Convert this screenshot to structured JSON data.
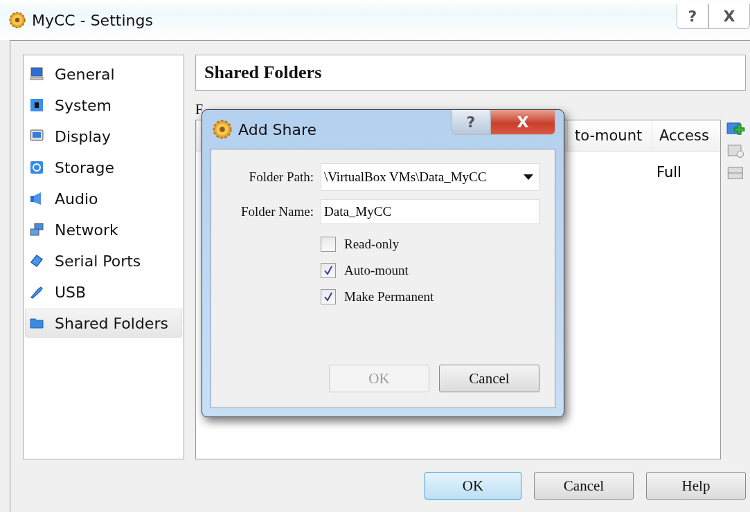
{
  "window": {
    "title": "MyCC - Settings",
    "buttons": [
      "?",
      "X"
    ]
  },
  "sidebar": {
    "items": [
      {
        "label": "General",
        "selected": false
      },
      {
        "label": "System",
        "selected": false
      },
      {
        "label": "Display",
        "selected": false
      },
      {
        "label": "Storage",
        "selected": false
      },
      {
        "label": "Audio",
        "selected": false
      },
      {
        "label": "Network",
        "selected": false
      },
      {
        "label": "Serial Ports",
        "selected": false
      },
      {
        "label": "USB",
        "selected": false
      },
      {
        "label": "Shared Folders",
        "selected": true
      }
    ]
  },
  "page": {
    "title": "Shared Folders",
    "folder_list_label": "F",
    "table": {
      "columns": [
        "to-mount",
        "Access"
      ],
      "rows": [
        [
          "",
          "Full"
        ]
      ]
    },
    "toolbar": [
      {
        "kind": "add",
        "disabled": false
      },
      {
        "kind": "edit",
        "disabled": true
      },
      {
        "kind": "remove",
        "disabled": true
      }
    ]
  },
  "dialog": {
    "title": "Add Share",
    "buttons": [
      "?",
      "X"
    ],
    "fields": [
      {
        "label": "Folder Path:",
        "value": "\\VirtualBox VMs\\Data_MyCC",
        "kind": "combo"
      },
      {
        "label": "Folder Name:",
        "value": "Data_MyCC",
        "kind": "text"
      }
    ],
    "checkboxes": [
      {
        "label": "Read-only",
        "checked": false
      },
      {
        "label": "Auto-mount",
        "checked": true
      },
      {
        "label": "Make Permanent",
        "checked": true
      }
    ],
    "actions": [
      {
        "label": "OK",
        "disabled": true
      },
      {
        "label": "Cancel",
        "disabled": false
      }
    ]
  },
  "footer": {
    "buttons": [
      {
        "label": "OK",
        "default": true
      },
      {
        "label": "Cancel",
        "default": false
      },
      {
        "label": "Help",
        "default": false
      }
    ]
  }
}
